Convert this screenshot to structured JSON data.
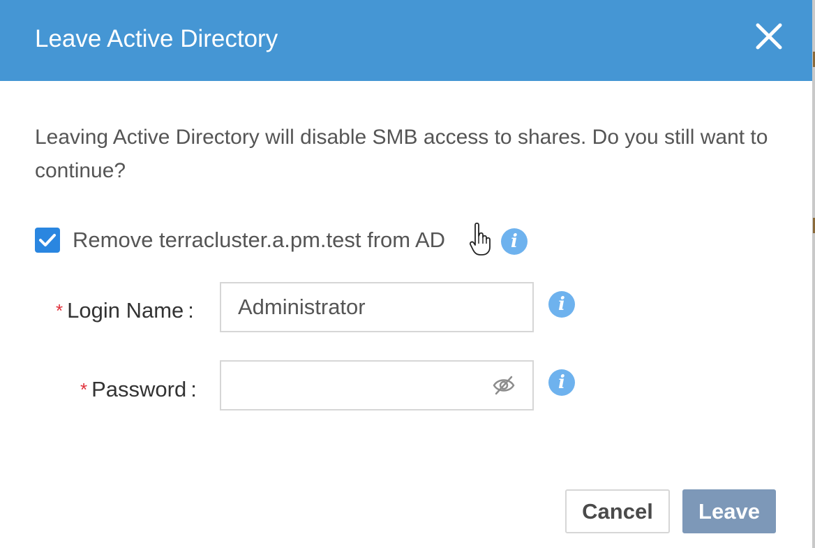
{
  "dialog": {
    "title": "Leave Active Directory",
    "close_icon": "close-icon",
    "message": "Leaving Active Directory will disable SMB access to shares. Do you still want to continue?"
  },
  "remove_option": {
    "checked": true,
    "label": "Remove terracluster.a.pm.test from AD",
    "info_icon": "info-icon"
  },
  "form": {
    "required_mark": "*",
    "login_name": {
      "label": "Login Name",
      "separator": ":",
      "value": "Administrator",
      "info_icon": "info-icon"
    },
    "password": {
      "label": "Password",
      "separator": ":",
      "value": "",
      "visibility_icon": "eye-off-icon",
      "info_icon": "info-icon"
    }
  },
  "buttons": {
    "cancel": "Cancel",
    "leave": "Leave"
  },
  "colors": {
    "header": "#4596d4",
    "checkbox": "#2a86e0",
    "info": "#6eb2ee",
    "required": "#e0303a",
    "leave_button": "#7d98b8"
  }
}
